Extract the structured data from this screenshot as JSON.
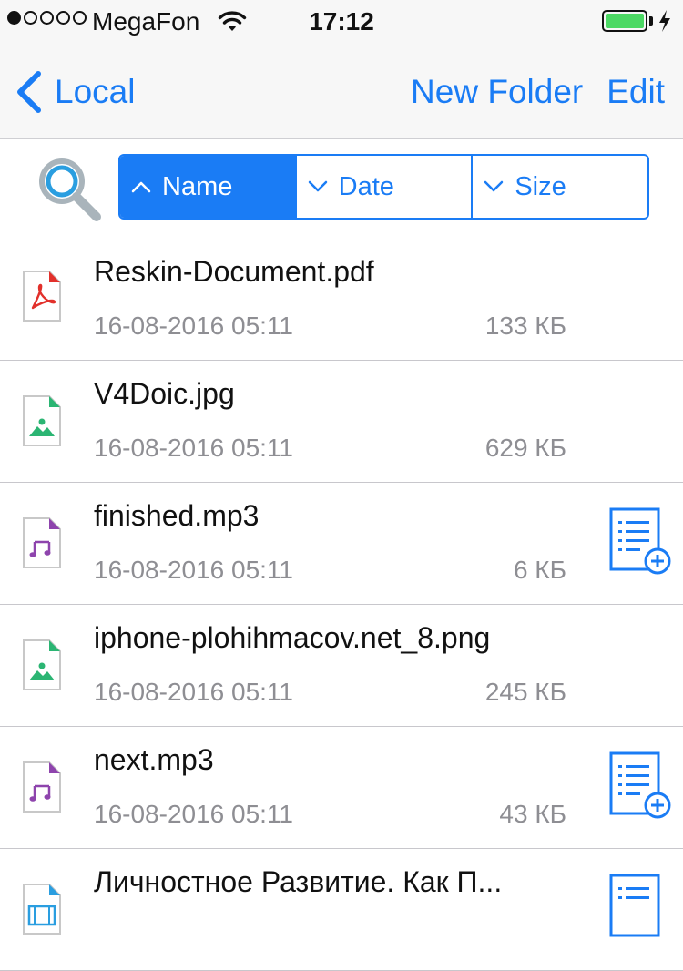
{
  "status_bar": {
    "signal_dots": [
      "full",
      "empty",
      "empty",
      "empty",
      "empty"
    ],
    "carrier": "MegaFon",
    "time": "17:12",
    "battery_color": "#4cd964"
  },
  "nav": {
    "back_label": "Local",
    "new_folder_label": "New Folder",
    "edit_label": "Edit"
  },
  "sort": {
    "options": [
      {
        "label": "Name",
        "direction": "up",
        "active": true
      },
      {
        "label": "Date",
        "direction": "down",
        "active": false
      },
      {
        "label": "Size",
        "direction": "down",
        "active": false
      }
    ]
  },
  "files": [
    {
      "name": "Reskin-Document.pdf",
      "date": "16-08-2016 05:11",
      "size": "133 КБ",
      "type": "pdf",
      "playlist": false
    },
    {
      "name": "V4Doic.jpg",
      "date": "16-08-2016 05:11",
      "size": "629 КБ",
      "type": "image",
      "playlist": false
    },
    {
      "name": "finished.mp3",
      "date": "16-08-2016 05:11",
      "size": "6 КБ",
      "type": "audio",
      "playlist": true
    },
    {
      "name": "iphone-plohihmacov.net_8.png",
      "date": "16-08-2016 05:11",
      "size": "245 КБ",
      "type": "image",
      "playlist": false
    },
    {
      "name": "next.mp3",
      "date": "16-08-2016 05:11",
      "size": "43 КБ",
      "type": "audio",
      "playlist": true
    },
    {
      "name": "Личностное Развитие. Как П...",
      "date": "",
      "size": "",
      "type": "video",
      "playlist": true
    }
  ],
  "colors": {
    "accent": "#1a7cf5",
    "pdf": "#e2302b",
    "image": "#2bb573",
    "audio": "#8e44ad",
    "video": "#2a9ee0"
  }
}
